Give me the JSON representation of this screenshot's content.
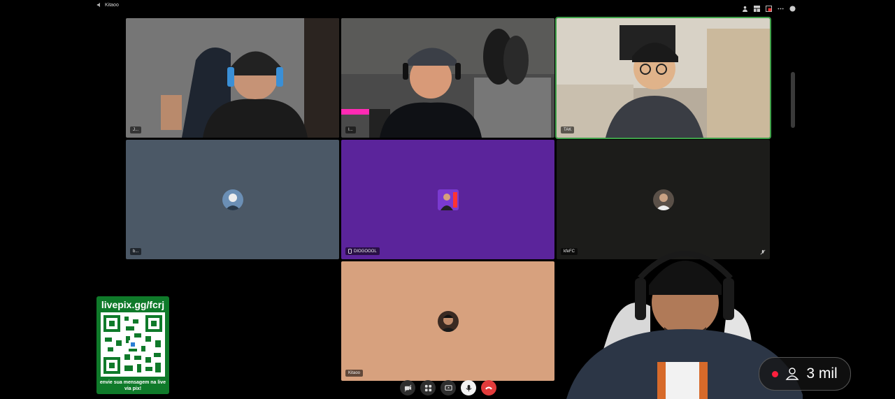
{
  "header": {
    "channel_name": "Kitaoo"
  },
  "tiles": [
    {
      "label": "J...",
      "bg": "#6e6e6e"
    },
    {
      "label": "I...",
      "bg": "#3a3a3a"
    },
    {
      "label": "TAK",
      "bg": "#8b7d6b"
    },
    {
      "label": "b...",
      "bg": "#4b5866"
    },
    {
      "label": "DIOGOOOL",
      "bg": "#5b249b"
    },
    {
      "label": "kfeFC",
      "bg": "#1c1c1a"
    },
    {
      "label": "Kitaoo",
      "bg": "#d7a17e"
    }
  ],
  "pix_panel": {
    "url": "livepix.gg/fcrj",
    "message": "envie sua mensagem na live via pix!"
  },
  "viewer_count": "3 mil",
  "colors": {
    "pix_green": "#0f7a2a",
    "live_red": "#ff1f3d",
    "hangup": "#e23b3b",
    "active_border": "#3fa14a"
  }
}
